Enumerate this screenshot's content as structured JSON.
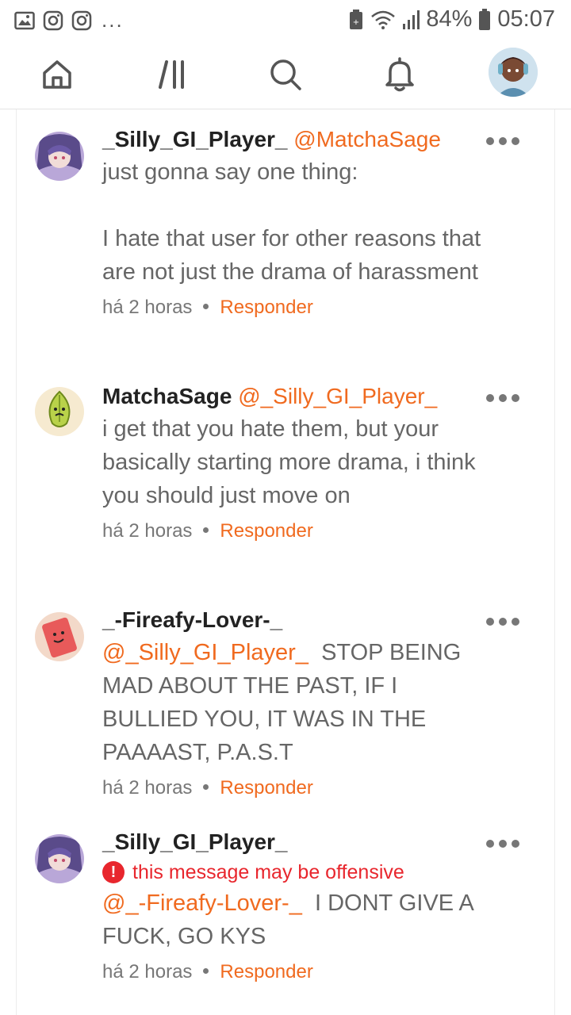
{
  "status_bar": {
    "battery": "84%",
    "time": "05:07",
    "left_icons": [
      "gallery-icon",
      "instagram-icon",
      "instagram-icon"
    ],
    "more": "..."
  },
  "nav": {
    "items": [
      "home-icon",
      "feed-icon",
      "search-icon",
      "bell-icon",
      "profile-avatar"
    ]
  },
  "comments": [
    {
      "username": "_Silly_GI_Player_",
      "mention": "@MatchaSage",
      "text": "just gonna say one thing:\n\nI hate that user for other reasons that are not just the drama of harassment",
      "time": "há 2 horas",
      "reply": "Responder"
    },
    {
      "username": "MatchaSage",
      "mention": "@_Silly_GI_Player_",
      "text": "i get that you hate them, but your basically starting more drama, i think you should just move on",
      "time": "há 2 horas",
      "reply": "Responder"
    },
    {
      "username": "_-Fireafy-Lover-_",
      "mention": "@_Silly_GI_Player_",
      "text": "STOP BEING MAD ABOUT THE PAST, IF I BULLIED YOU, IT WAS IN THE PAAAAST, P.A.S.T",
      "time": "há 2 horas",
      "reply": "Responder"
    },
    {
      "username": "_Silly_GI_Player_",
      "warning": "this message may be offensive",
      "mention": "@_-Fireafy-Lover-_",
      "text": "I DONT GIVE A FUCK, GO KYS",
      "time": "há 2 horas",
      "reply": "Responder"
    }
  ],
  "colors": {
    "accent": "#f06a1f",
    "warning": "#e8262d"
  }
}
